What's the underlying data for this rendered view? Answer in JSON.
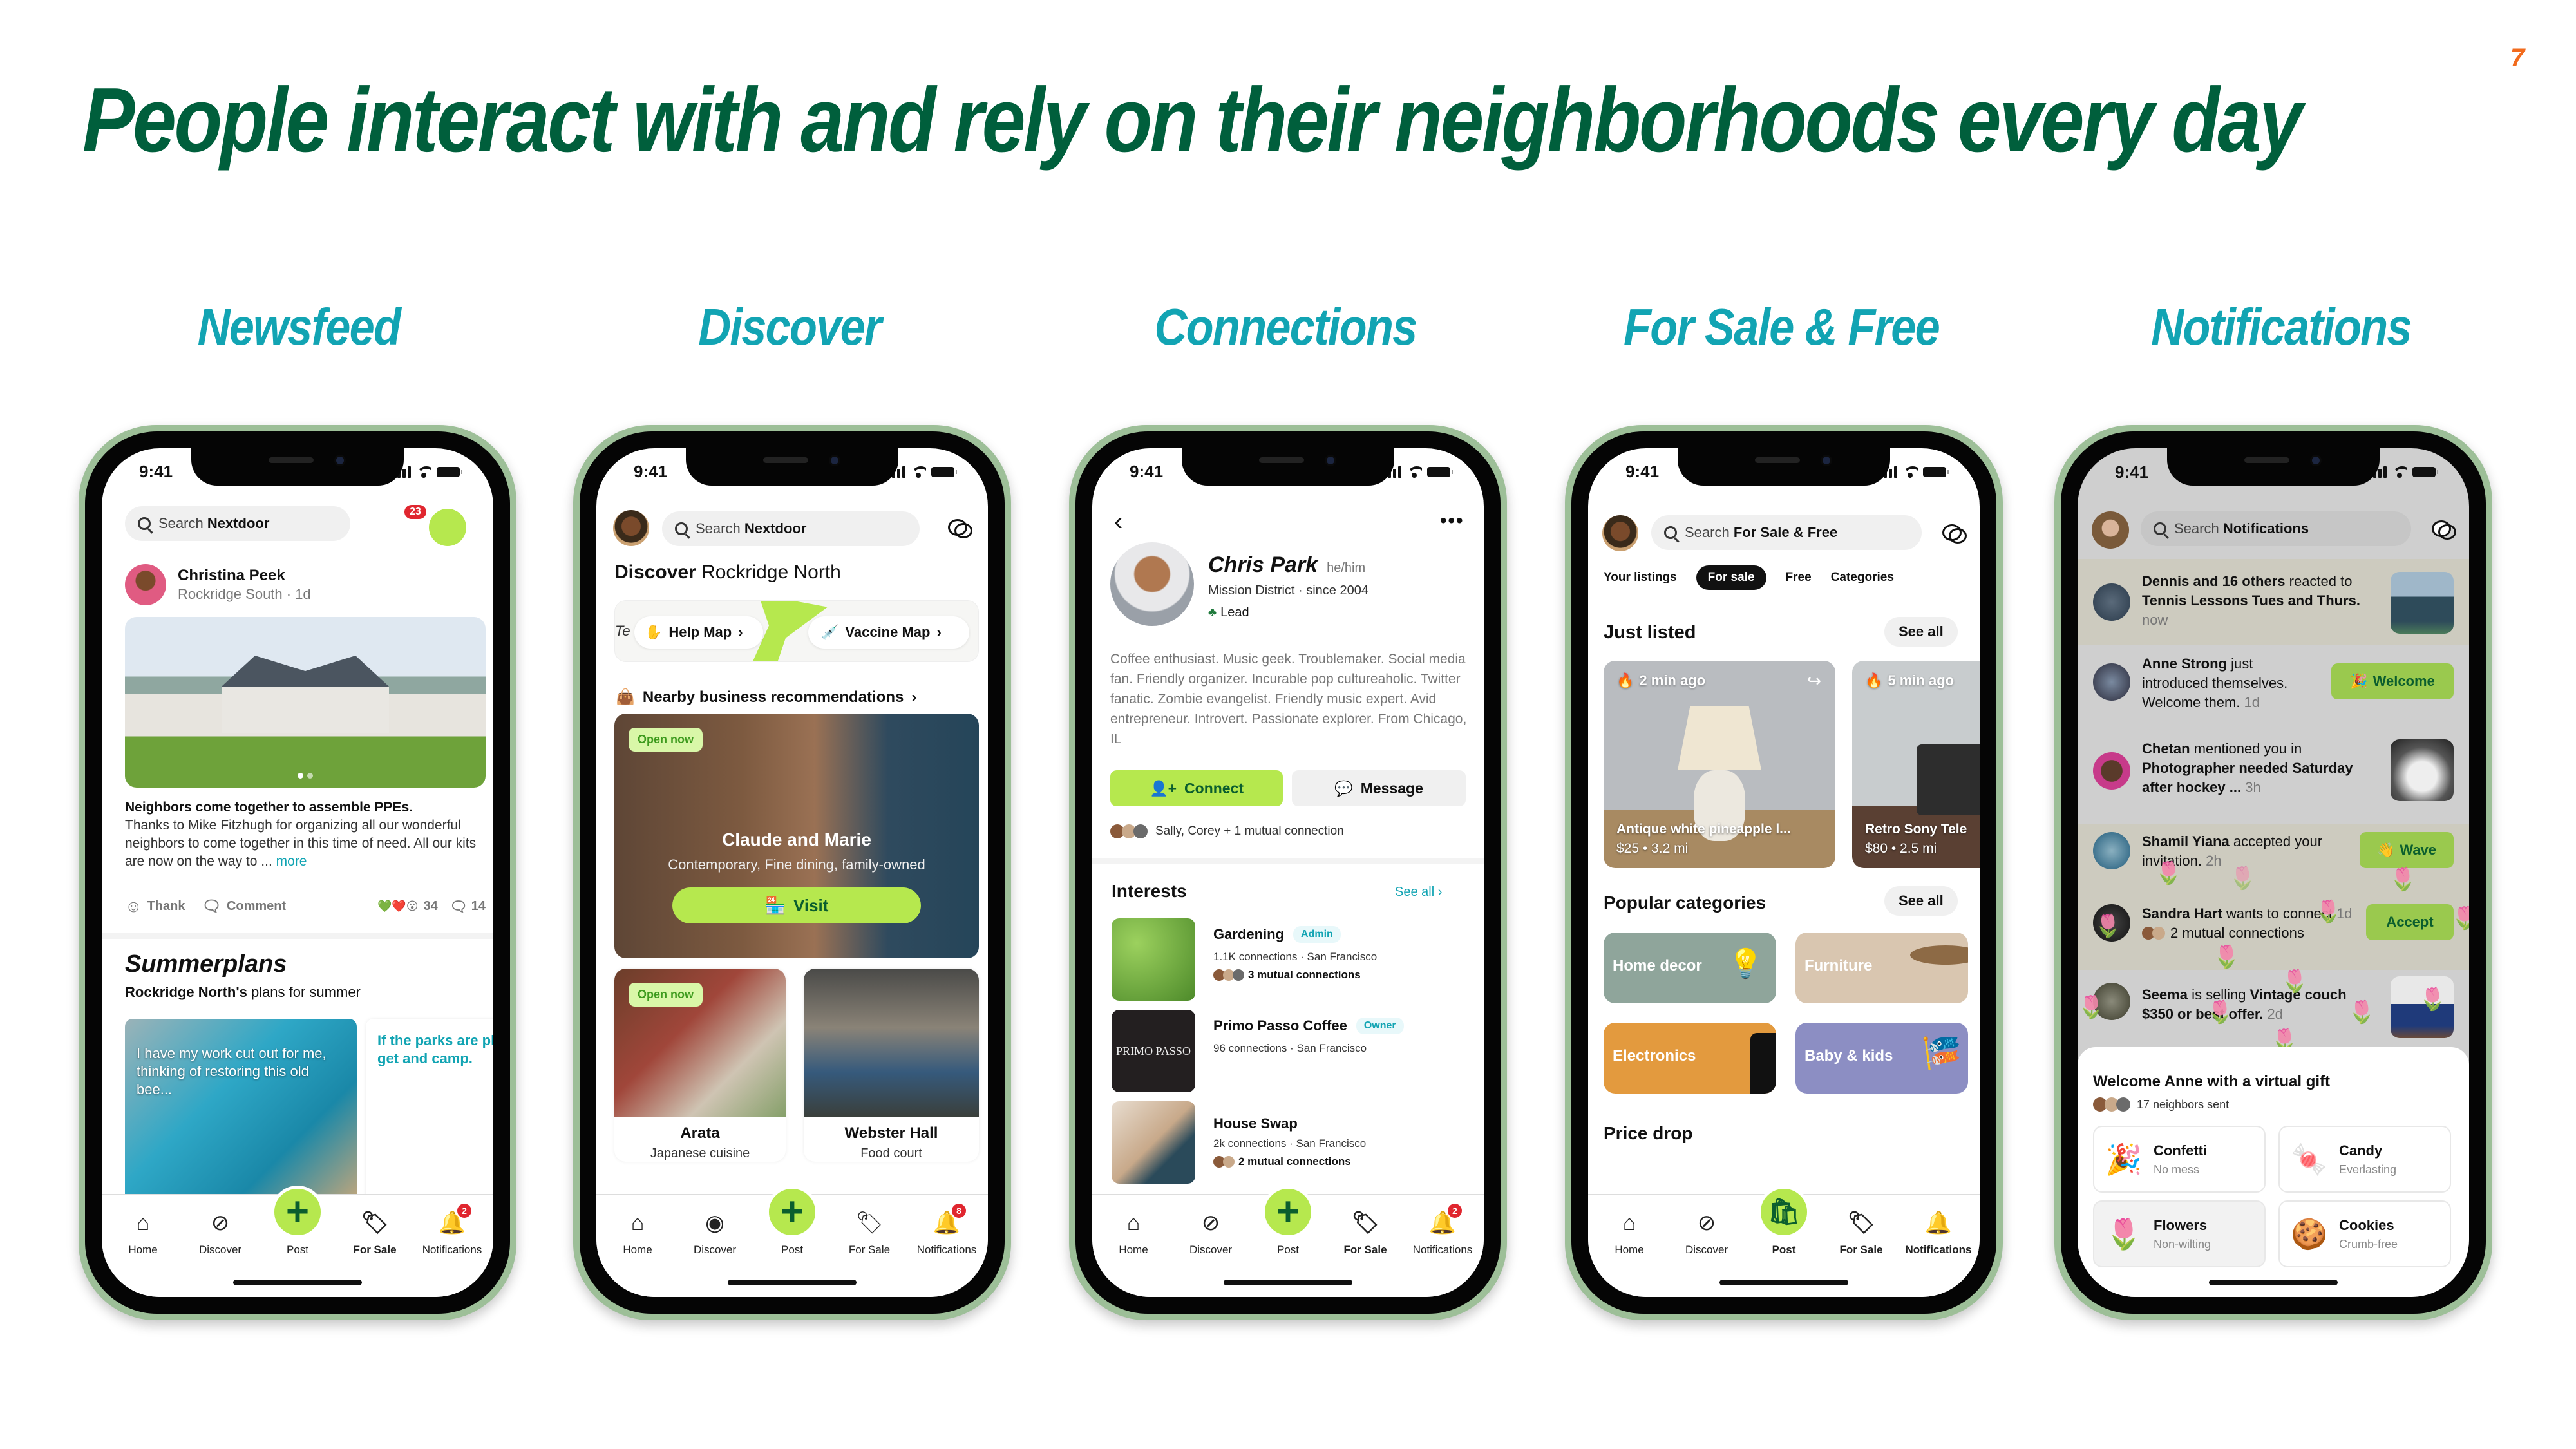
{
  "slide": {
    "page_number": "7",
    "title": "People interact with and rely on their neighborhoods every day",
    "colors": {
      "title": "#005F3C",
      "section": "#12A4B3",
      "page_number": "#F26B1D",
      "accent_green": "#B6E84E",
      "phone_frame": "#9DBF98"
    }
  },
  "sections": [
    "Newsfeed",
    "Discover",
    "Connections",
    "For Sale & Free",
    "Notifications"
  ],
  "status_time": "9:41",
  "tabbar": {
    "home": "Home",
    "discover": "Discover",
    "post": "Post",
    "for_sale": "For Sale",
    "notifications": "Notifications"
  },
  "newsfeed": {
    "search_prefix": "Search ",
    "search_bold": "Nextdoor",
    "notif_count": "23",
    "post": {
      "author": "Christina Peek",
      "meta": "Rockridge South · 1d",
      "headline": "Neighbors come together to assemble PPEs.",
      "body": "Thanks to Mike Fitzhugh for organizing all our wonderful neighbors to come together in this time of need. All our kits are now on the way to ... ",
      "more": "more",
      "thank": "Thank",
      "comment": "Comment",
      "reactions": "34",
      "comments": "14"
    },
    "summer": {
      "title": "Summerplans",
      "subtitle_bold": "Rockridge North's",
      "subtitle_rest": " plans for summer",
      "card1": "I have my work cut out for me, thinking of restoring this old bee...",
      "card2": "If the parks are planning to get and camp."
    },
    "tab_badge": "2"
  },
  "discover": {
    "search_prefix": "Search ",
    "search_bold": "Nextdoor",
    "heading_bold": "Discover",
    "heading_rest": " Rockridge North",
    "map_edge_text": "Te",
    "help_map": "Help Map",
    "vaccine_map": "Vaccine Map",
    "nearby": "Nearby business recommendations",
    "featured": {
      "open": "Open now",
      "name": "Claude and Marie",
      "desc": "Contemporary, Fine dining, family-owned",
      "visit": "Visit"
    },
    "biz": [
      {
        "open": "Open now",
        "name": "Arata",
        "desc": "Japanese cuisine"
      },
      {
        "name": "Webster Hall",
        "desc": "Food court"
      }
    ],
    "tab_badge": "8"
  },
  "connections": {
    "name": "Chris Park",
    "pronouns": "he/him",
    "location": "Mission District ·  since 2004",
    "role": "Lead",
    "bio": "Coffee enthusiast. Music geek. Troublemaker. Social media fan. Friendly organizer. Incurable pop cultureaholic. Twitter fanatic. Zombie evangelist. Friendly music expert. Avid entrepreneur. Introvert. Passionate explorer. From Chicago, IL",
    "connect": "Connect",
    "message": "Message",
    "mutual": "Sally, Corey + 1 mutual connection",
    "interests_title": "Interests",
    "see_all": "See all",
    "interests": [
      {
        "name": "Gardening",
        "badge": "Admin",
        "meta": "1.1K connections  ·  San Francisco",
        "mutual": "3 mutual connections"
      },
      {
        "name": "Primo Passo Coffee",
        "badge": "Owner",
        "meta": "96 connections  ·  San Francisco",
        "mutual": ""
      },
      {
        "name": "House Swap",
        "badge": "",
        "meta": "2k connections  ·  San Francisco",
        "mutual": "2 mutual connections"
      }
    ],
    "coffee_logo": "PRIMO PASSO",
    "tab_badge": "2"
  },
  "forsale": {
    "search_prefix": "Search ",
    "search_bold": "For Sale & Free",
    "filters": [
      "Your listings",
      "For sale",
      "Free",
      "Categories"
    ],
    "active_filter": "For sale",
    "just_listed": "Just listed",
    "see_all": "See all",
    "listings": [
      {
        "time": "2 min ago",
        "title": "Antique white pineapple l...",
        "meta": "$25 • 3.2 mi"
      },
      {
        "time": "5 min ago",
        "title": "Retro Sony Tele",
        "meta": "$80 • 2.5 mi"
      }
    ],
    "popular": "Popular categories",
    "categories": [
      "Home decor",
      "Furniture",
      "Electronics",
      "Baby & kids"
    ],
    "price_drop": "Price drop"
  },
  "notifications": {
    "search_prefix": "Search ",
    "search_bold": "Notifications",
    "items": [
      {
        "bold": "Dennis and 16 others",
        "text": " reacted to ",
        "bold2": "Tennis Lessons Tues and Thurs.",
        "time": "now"
      },
      {
        "bold": "Anne Strong",
        "text": " just introduced themselves. Welcome them.",
        "time": "1d",
        "action": "Welcome"
      },
      {
        "bold": "Chetan",
        "text": " mentioned you in ",
        "bold2": "Photographer needed Saturday after hockey ...",
        "time": "3h"
      },
      {
        "bold": "Shamil Yiana",
        "text": " accepted your invitation.",
        "time": "2h",
        "action": "Wave"
      },
      {
        "bold": "Sandra Hart",
        "text": " wants to connect",
        "time": "1d",
        "mutual": "2 mutual connections",
        "action": "Accept"
      },
      {
        "bold": "Seema",
        "text": " is selling ",
        "bold2": "Vintage couch $350 or best offer.",
        "time": "2d"
      }
    ],
    "sheet": {
      "title": "Welcome Anne with a virtual gift",
      "sent": "17 neighbors sent",
      "gifts": [
        {
          "name": "Confetti",
          "sub": "No mess",
          "icon": "🎉"
        },
        {
          "name": "Candy",
          "sub": "Everlasting",
          "icon": "🍬"
        },
        {
          "name": "Flowers",
          "sub": "Non-wilting",
          "icon": "🌷"
        },
        {
          "name": "Cookies",
          "sub": "Crumb-free",
          "icon": "🍪"
        }
      ]
    }
  }
}
